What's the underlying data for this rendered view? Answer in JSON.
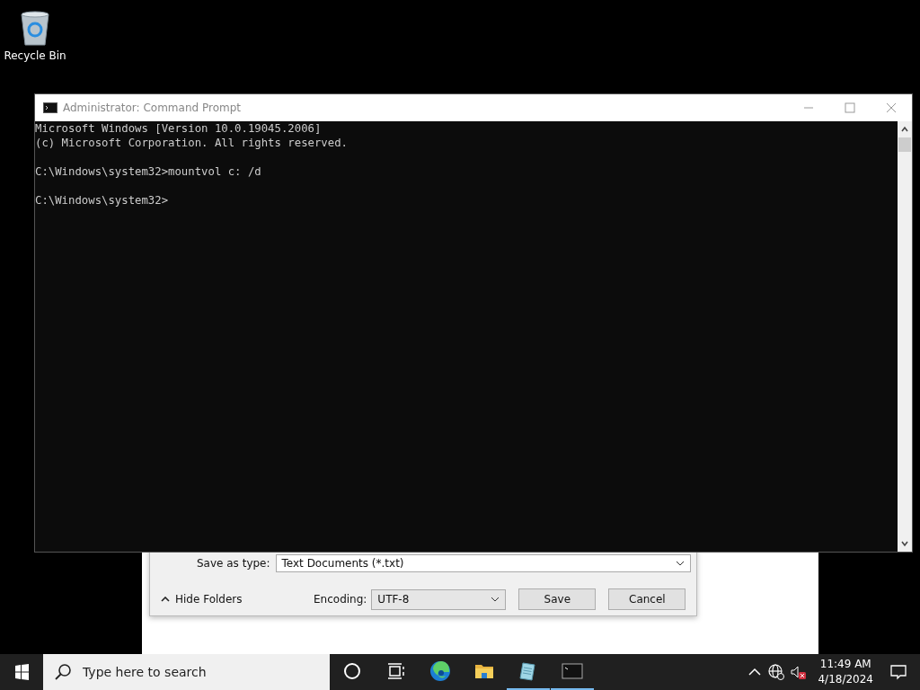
{
  "desktop_icons": [
    {
      "label": "Recycle Bin"
    }
  ],
  "console": {
    "title": "Administrator: Command Prompt",
    "blocks": [
      [
        "Microsoft Windows [Version 10.0.19045.2006]",
        "(c) Microsoft Corporation. All rights reserved."
      ],
      [
        "C:\\Windows\\system32>mountvol c: /d"
      ],
      [
        "C:\\Windows\\system32>"
      ]
    ]
  },
  "save_dialog": {
    "type_label": "Save as type:",
    "type_value": "Text Documents (*.txt)",
    "hide_folders": "Hide Folders",
    "encoding_label": "Encoding:",
    "encoding_value": "UTF-8",
    "buttons": [
      "Save",
      "Cancel"
    ]
  },
  "taskbar": {
    "search": {
      "placeholder": "Type here to search"
    },
    "apps": [
      {
        "kind": "cortana",
        "running": false
      },
      {
        "kind": "taskview",
        "running": false
      },
      {
        "kind": "edge",
        "running": false
      },
      {
        "kind": "explorer",
        "running": false
      },
      {
        "kind": "notepad",
        "running": true
      },
      {
        "kind": "cmd",
        "running": true
      }
    ],
    "time": "11:49 AM",
    "date": "4/18/2024"
  }
}
